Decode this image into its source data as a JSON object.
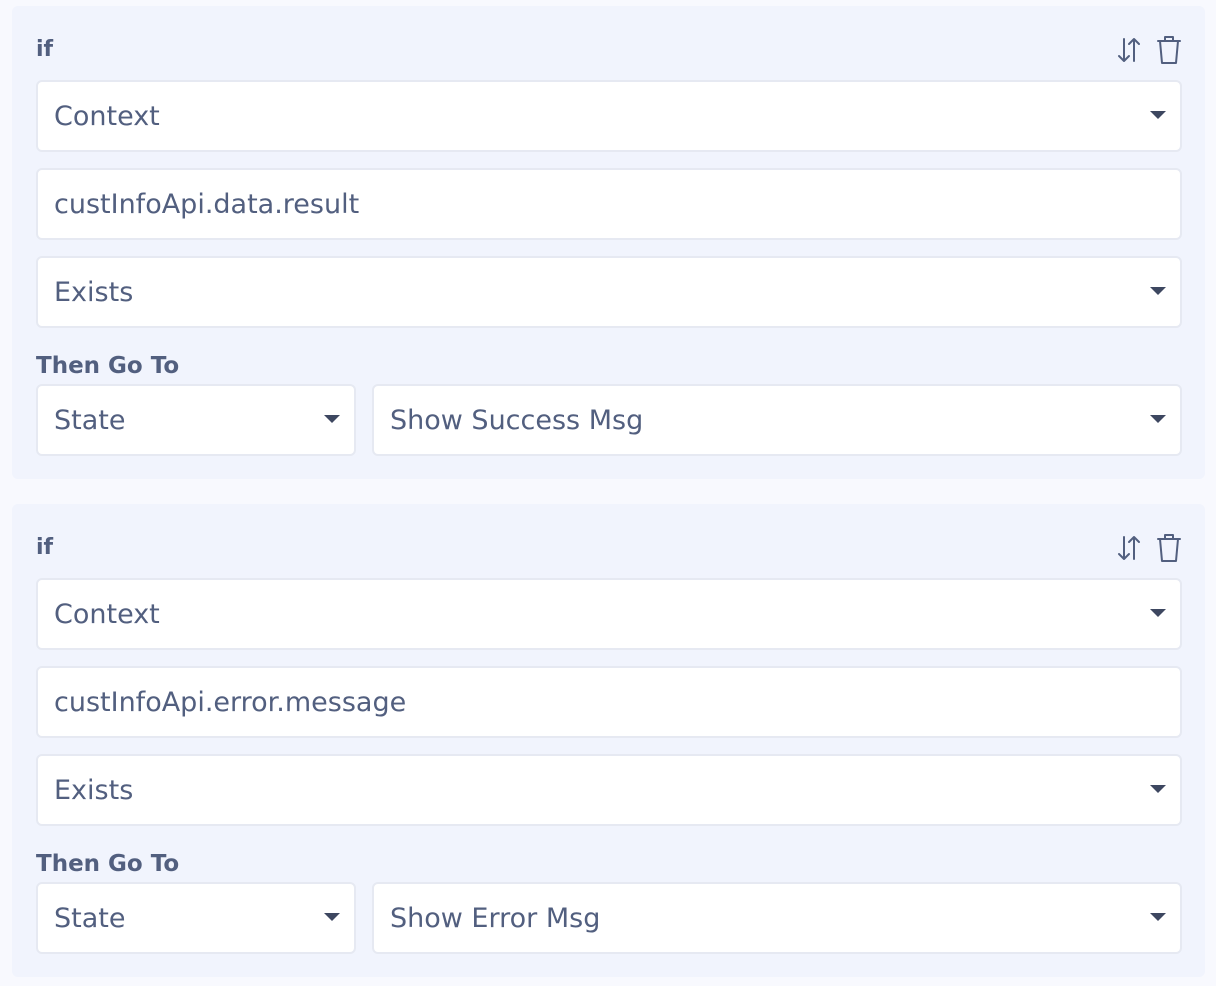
{
  "rules": [
    {
      "if_label": "if",
      "source": "Context",
      "path": "custInfoApi.data.result",
      "operator": "Exists",
      "then_label": "Then Go To",
      "target_type": "State",
      "target": "Show Success Msg"
    },
    {
      "if_label": "if",
      "source": "Context",
      "path": "custInfoApi.error.message",
      "operator": "Exists",
      "then_label": "Then Go To",
      "target_type": "State",
      "target": "Show Error Msg"
    }
  ],
  "icons": {
    "reorder": "sort-arrows-icon",
    "delete": "trash-icon"
  },
  "colors": {
    "background": "#f8f9fe",
    "card": "#f1f4fd",
    "text": "#525f7f",
    "border": "#e6e9f2"
  }
}
